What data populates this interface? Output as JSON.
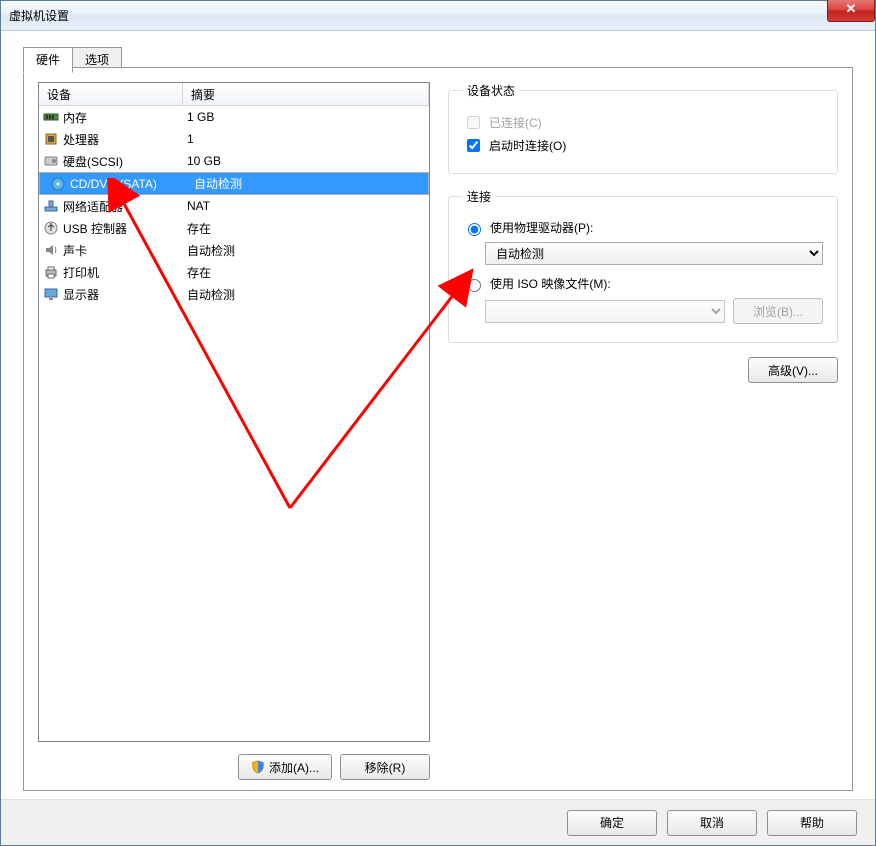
{
  "window": {
    "title": "虚拟机设置"
  },
  "tabs": {
    "hardware": "硬件",
    "options": "选项"
  },
  "list": {
    "col_device": "设备",
    "col_summary": "摘要",
    "rows": [
      {
        "name": "内存",
        "summary": "1 GB",
        "icon": "memory"
      },
      {
        "name": "处理器",
        "summary": "1",
        "icon": "cpu"
      },
      {
        "name": "硬盘(SCSI)",
        "summary": "10 GB",
        "icon": "hdd"
      },
      {
        "name": "CD/DVD (SATA)",
        "summary": "自动检测",
        "icon": "cd",
        "selected": true
      },
      {
        "name": "网络适配器",
        "summary": "NAT",
        "icon": "net"
      },
      {
        "name": "USB 控制器",
        "summary": "存在",
        "icon": "usb"
      },
      {
        "name": "声卡",
        "summary": "自动检测",
        "icon": "sound"
      },
      {
        "name": "打印机",
        "summary": "存在",
        "icon": "printer"
      },
      {
        "name": "显示器",
        "summary": "自动检测",
        "icon": "display"
      }
    ]
  },
  "buttons": {
    "add": "添加(A)...",
    "remove": "移除(R)",
    "advanced": "高级(V)...",
    "browse": "浏览(B)...",
    "ok": "确定",
    "cancel": "取消",
    "help": "帮助"
  },
  "status": {
    "legend": "设备状态",
    "connected": "已连接(C)",
    "connected_checked": false,
    "connected_enabled": false,
    "connect_on": "启动时连接(O)",
    "connect_on_checked": true
  },
  "connection": {
    "legend": "连接",
    "physical": "使用物理驱动器(P):",
    "physical_option": "自动检测",
    "iso": "使用 ISO 映像文件(M):",
    "iso_path": "",
    "selected": "physical"
  }
}
